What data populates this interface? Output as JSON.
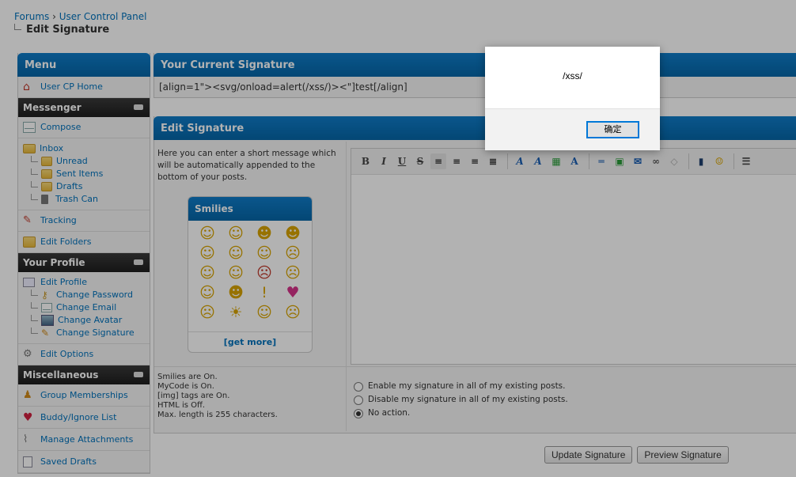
{
  "breadcrumb": {
    "root": "Forums",
    "sep": " › ",
    "parent": "User Control Panel",
    "current": "Edit Signature"
  },
  "sidebar": {
    "title": "Menu",
    "home": "User CP Home",
    "messenger": {
      "title": "Messenger",
      "compose": "Compose",
      "inbox": "Inbox",
      "folders": [
        "Unread",
        "Sent Items",
        "Drafts",
        "Trash Can"
      ],
      "tracking": "Tracking",
      "edit_folders": "Edit Folders"
    },
    "profile": {
      "title": "Your Profile",
      "edit_profile": "Edit Profile",
      "items": [
        "Change Password",
        "Change Email",
        "Change Avatar",
        "Change Signature"
      ],
      "edit_options": "Edit Options"
    },
    "misc": {
      "title": "Miscellaneous",
      "items": [
        "Group Memberships",
        "Buddy/Ignore List",
        "Manage Attachments",
        "Saved Drafts"
      ]
    }
  },
  "current_signature": {
    "title": "Your Current Signature",
    "text": "[align=1\"><svg/onload=alert(/xss/)><\"]test[/align]"
  },
  "edit_signature": {
    "title": "Edit Signature",
    "help": "Here you can enter a short message which will be automatically appended to the bottom of your posts.",
    "smilies_title": "Smilies",
    "get_more": "[get more]",
    "status": [
      "Smilies are On.",
      "MyCode is On.",
      "[img] tags are On.",
      "HTML is Off.",
      "Max. length is 255 characters."
    ],
    "options": [
      {
        "label": "Enable my signature in all of my existing posts.",
        "checked": false
      },
      {
        "label": "Disable my signature in all of my existing posts.",
        "checked": false
      },
      {
        "label": "No action.",
        "checked": true
      }
    ],
    "toolbar": [
      "bold-icon",
      "italic-icon",
      "underline-icon",
      "strikethrough-icon",
      "align-left-icon",
      "align-center-icon",
      "align-right-icon",
      "align-justify-icon",
      "font-icon",
      "size-icon",
      "color-icon",
      "remove-format-icon",
      "hr-icon",
      "image-icon",
      "email-icon",
      "link-icon",
      "unlink-icon",
      "video-icon",
      "emoticon-icon",
      "list-icon"
    ]
  },
  "buttons": {
    "update": "Update Signature",
    "preview": "Preview Signature"
  },
  "alert": {
    "message": "/xss/",
    "ok": "确定"
  },
  "colors": {
    "header": "#0666a7",
    "category": "#1e1e1e",
    "link": "#0072bc"
  }
}
